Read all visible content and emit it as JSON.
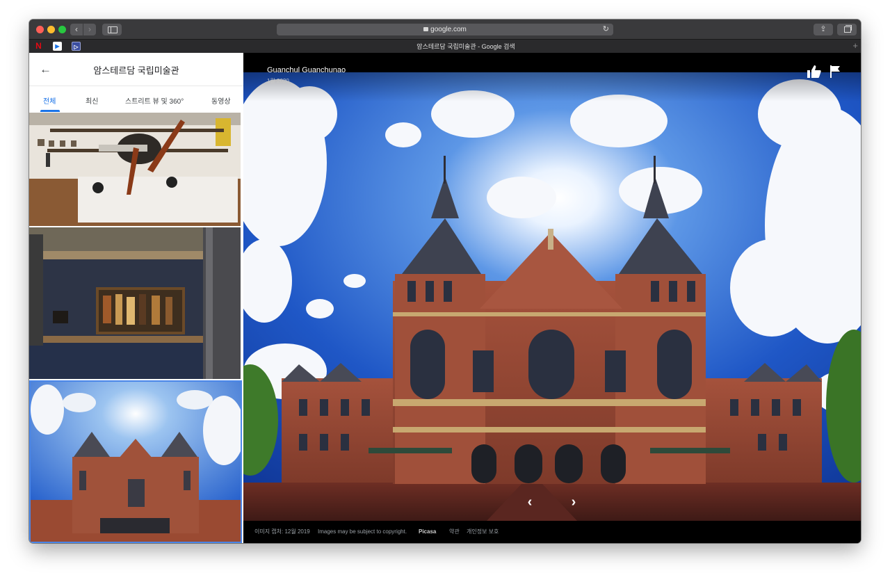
{
  "browser": {
    "url": "google.com",
    "tab_title": "암스테르담 국립미술관 - Google 검색",
    "favicons": [
      "netflix-icon",
      "play-icon",
      "prime-video-icon"
    ]
  },
  "panel": {
    "title": "암스테르담 국립미술관",
    "tabs": [
      {
        "label": "전체",
        "active": true
      },
      {
        "label": "최신",
        "active": false
      },
      {
        "label": "스트리트 뷰 및 360°",
        "active": false
      },
      {
        "label": "동영상",
        "active": false
      }
    ]
  },
  "viewer": {
    "author": "Guanchul Guanchunao",
    "date": "1월 2020",
    "footer": {
      "capture": "이미지 캡처: 12월 2019",
      "copyright": "Images may be subject to copyright.",
      "source": "Picasa",
      "terms": "약관",
      "privacy": "개인정보 보호"
    }
  },
  "colors": {
    "accent": "#1a73e8",
    "selected_border": "#4a86e8",
    "viewer_bg": "#000000"
  }
}
